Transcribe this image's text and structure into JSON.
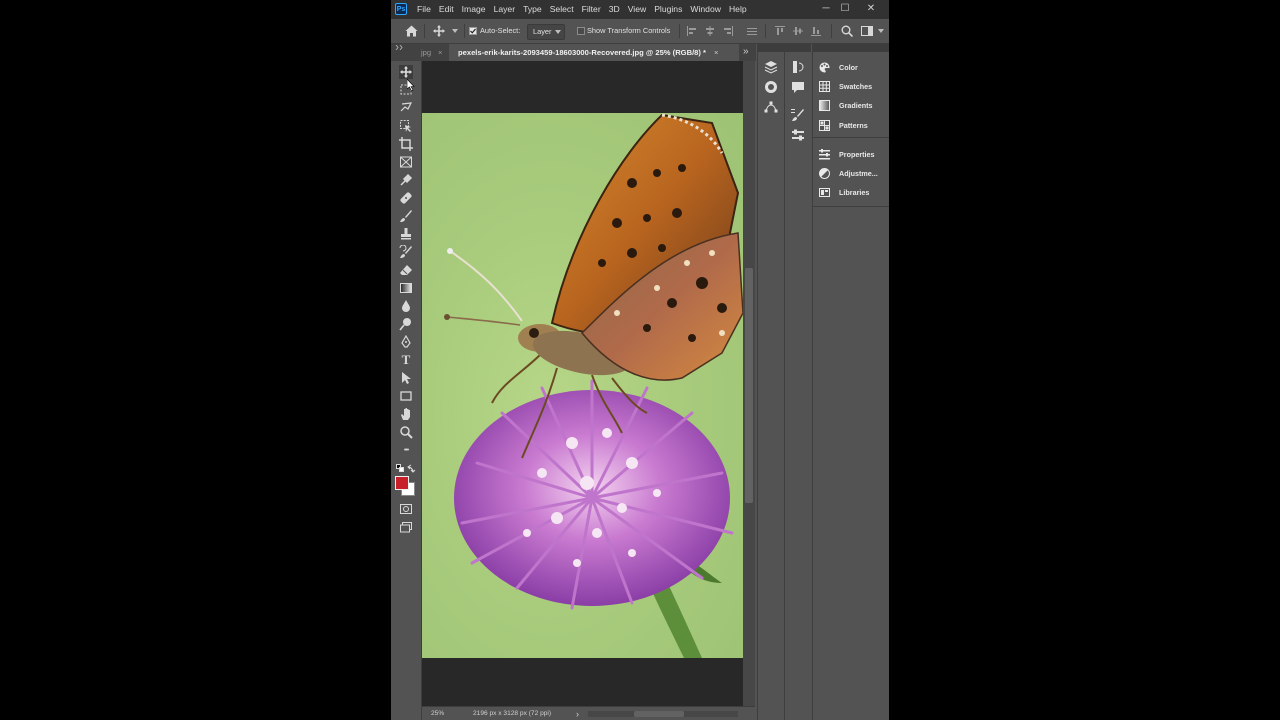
{
  "app": {
    "logo": "Ps"
  },
  "menu": [
    "File",
    "Edit",
    "Image",
    "Layer",
    "Type",
    "Select",
    "Filter",
    "3D",
    "View",
    "Plugins",
    "Window",
    "Help"
  ],
  "window_controls": {
    "minimize": "─",
    "maximize": "☐",
    "close": "✕"
  },
  "options_bar": {
    "auto_select_label": "Auto-Select:",
    "auto_select_checked": true,
    "auto_select_value": "Layer",
    "transform_label": "Show Transform Controls",
    "transform_checked": false
  },
  "tabs": [
    {
      "label": "jpg",
      "active": false
    },
    {
      "label": "pexels-erik-karits-2093459-18603000-Recovered.jpg @ 25% (RGB/8) *",
      "active": true
    }
  ],
  "tab_overflow": "»",
  "tools": [
    "move-tool",
    "marquee-tool",
    "lasso-tool",
    "object-select-tool",
    "crop-tool",
    "frame-tool",
    "eyedropper-tool",
    "healing-brush-tool",
    "brush-tool",
    "clone-stamp-tool",
    "history-brush-tool",
    "eraser-tool",
    "gradient-tool",
    "blur-tool",
    "dodge-tool",
    "pen-tool",
    "type-tool",
    "path-select-tool",
    "rectangle-tool",
    "hand-tool",
    "zoom-tool",
    "more-tools"
  ],
  "type_tool_glyph": "T",
  "more_glyph": "•••",
  "colors": {
    "foreground": "#c8202a",
    "background": "#ffffff",
    "ps_blue": "#31a8ff"
  },
  "status": {
    "zoom": "25%",
    "doc_info": "2196 px x 3128 px (72 ppi)",
    "arrow": "›"
  },
  "panels": [
    {
      "label": "Color",
      "icon": "color-palette-icon"
    },
    {
      "label": "Swatches",
      "icon": "swatches-grid-icon"
    },
    {
      "label": "Gradients",
      "icon": "gradients-icon"
    },
    {
      "label": "Patterns",
      "icon": "patterns-icon"
    },
    {
      "label": "Properties",
      "icon": "properties-icon"
    },
    {
      "label": "Adjustme...",
      "icon": "adjustments-icon"
    },
    {
      "label": "Libraries",
      "icon": "libraries-icon"
    }
  ]
}
